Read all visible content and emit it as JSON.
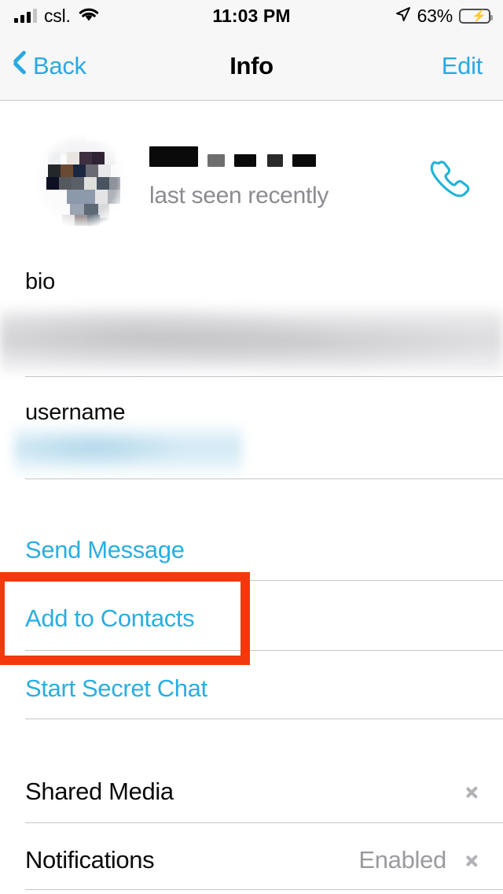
{
  "status_bar": {
    "carrier": "csl.",
    "time": "11:03 PM",
    "battery_percent": "63%",
    "signal_icon": "cellular-bars-icon",
    "wifi_icon": "wifi-icon",
    "location_icon": "location-arrow-icon",
    "battery_icon": "battery-charging-icon",
    "battery_level": 63,
    "battery_charging": true
  },
  "nav_bar": {
    "back_label": "Back",
    "title": "Info",
    "edit_label": "Edit",
    "back_icon": "chevron-left-icon"
  },
  "profile": {
    "name": "",
    "name_redacted": true,
    "status": "last seen recently",
    "avatar_icon": "avatar-pixelated",
    "call_icon": "phone-icon"
  },
  "fields": [
    {
      "label": "bio",
      "value": "",
      "redacted": true
    },
    {
      "label": "username",
      "value": "",
      "redacted": true
    }
  ],
  "actions": [
    {
      "label": "Send Message",
      "name": "send-message"
    },
    {
      "label": "Add to Contacts",
      "name": "add-to-contacts"
    },
    {
      "label": "Start Secret Chat",
      "name": "start-secret-chat"
    }
  ],
  "settings": [
    {
      "label": "Shared Media",
      "value": "",
      "chevron": true
    },
    {
      "label": "Notifications",
      "value": "Enabled",
      "chevron": true
    }
  ],
  "annotation": {
    "target": "Add to Contacts",
    "color": "#f4380e",
    "shape": "rectangle-outline"
  },
  "colors": {
    "accent": "#2aaee0",
    "link": "#2aa9e0",
    "separator": "#c6c6c8",
    "secondary_text": "#8b8b90",
    "bar_background": "#f7f7f8",
    "highlight": "#f4380e"
  }
}
